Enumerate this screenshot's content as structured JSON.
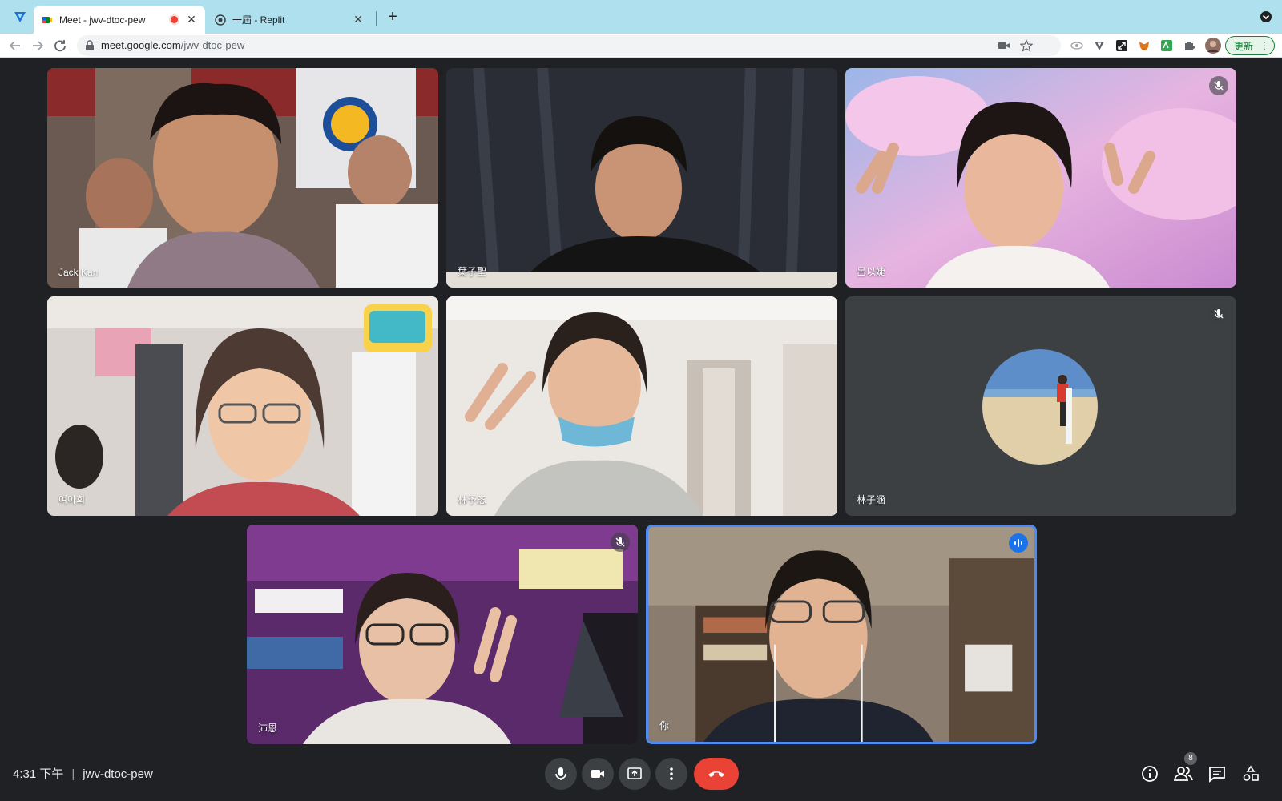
{
  "browser": {
    "tabs": [
      {
        "title": "Meet - jwv-dtoc-pew",
        "active": true,
        "recording": true
      },
      {
        "title": "一屆 - Replit",
        "active": false
      }
    ],
    "url_host": "meet.google.com",
    "url_path": "/jwv-dtoc-pew",
    "update_label": "更新",
    "icons": [
      "back-icon",
      "forward-icon",
      "reload-icon",
      "lock-icon",
      "camera-blocked-icon",
      "star-icon",
      "extensions-icon",
      "profile-avatar"
    ]
  },
  "participants": [
    {
      "name": "Jack Kan",
      "muted": false
    },
    {
      "name": "葉子聖",
      "muted": false
    },
    {
      "name": "呂以婕",
      "muted": true
    },
    {
      "name": "여아희",
      "muted": false
    },
    {
      "name": "林予忞",
      "muted": false
    },
    {
      "name": "林子涵",
      "muted": true,
      "camera_off": true
    },
    {
      "name": "沛恩",
      "muted": true
    },
    {
      "name": "你",
      "muted": false,
      "speaking": true
    }
  ],
  "bottom_bar": {
    "time": "4:31 下午",
    "meeting_code": "jwv-dtoc-pew",
    "people_count": "8"
  },
  "colors": {
    "background": "#202124",
    "end_call": "#ea4335",
    "active_border": "#4c8bf5",
    "tab_strip": "#aee0ee"
  }
}
